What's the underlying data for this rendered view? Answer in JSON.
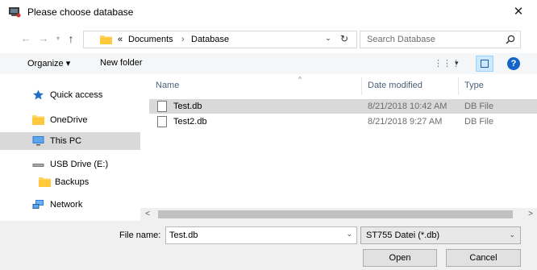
{
  "window": {
    "title": "Please choose database",
    "close_symbol": "✕"
  },
  "nav_buttons": {
    "back": "←",
    "forward": "→",
    "recent": "▾",
    "up": "↑"
  },
  "address": {
    "overflow": "«",
    "crumbs": [
      "Documents",
      "Database"
    ],
    "separator": "›",
    "dropdown": "⌄",
    "refresh": "↻"
  },
  "search": {
    "placeholder": "Search Database"
  },
  "toolbar": {
    "organize_label": "Organize ▾",
    "new_folder_label": "New folder",
    "view_options": "⋮⋮⋮",
    "view_dropdown": "▾",
    "help": "?"
  },
  "nav_pane": {
    "items": [
      {
        "label": "Quick access",
        "icon": "star-icon"
      },
      {
        "label": "OneDrive",
        "icon": "folder-icon"
      },
      {
        "label": "This PC",
        "icon": "monitor-icon",
        "selected": true
      },
      {
        "label": "USB Drive (E:)",
        "icon": "drive-icon"
      },
      {
        "label": "Backups",
        "icon": "folder-icon"
      },
      {
        "label": "Network",
        "icon": "network-icon"
      }
    ]
  },
  "file_list": {
    "columns": {
      "name": "Name",
      "date": "Date modified",
      "type": "Type",
      "sort_arrow": "^"
    },
    "rows": [
      {
        "name": "Test.db",
        "date": "8/21/2018 10:42 AM",
        "type": "DB  File",
        "selected": true
      },
      {
        "name": "Test2.db",
        "date": "8/21/2018 9:27 AM",
        "type": "DB  File",
        "selected": false
      }
    ]
  },
  "scrollbar": {
    "left": "<",
    "right": ">"
  },
  "bottom": {
    "file_name_label": "File name:",
    "file_name_value": "Test.db",
    "file_type_value": "ST755 Datei (*.db)",
    "open_label": "Open",
    "cancel_label": "Cancel",
    "dropdown": "⌄"
  },
  "colors": {
    "selected": "#d9d9d9",
    "accent": "#1565c8",
    "folder": "#ffd766"
  }
}
